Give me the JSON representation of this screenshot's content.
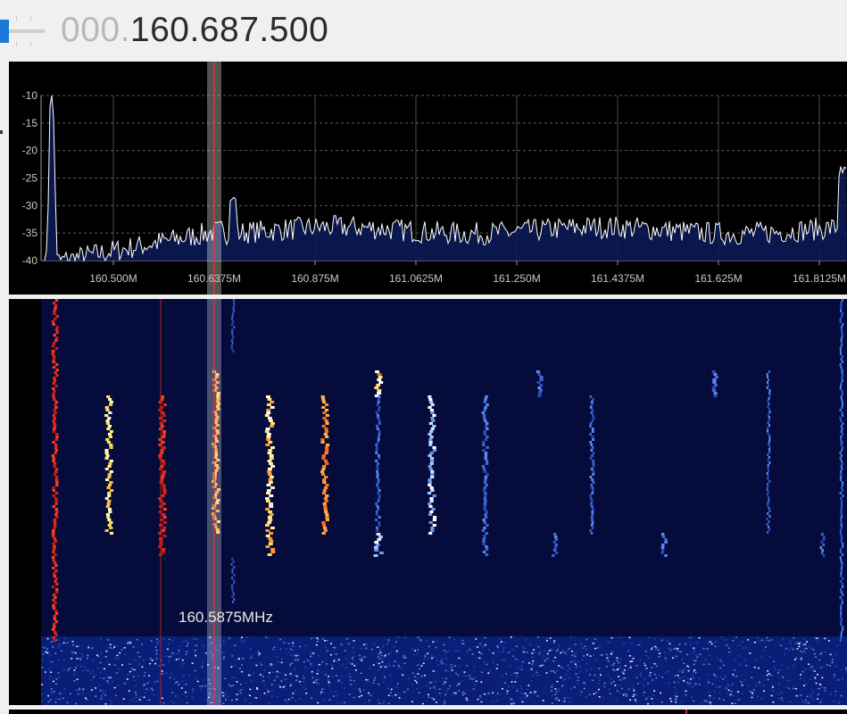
{
  "frequency": {
    "dim_part": "000.",
    "bright_part": "160.687.500"
  },
  "spectrum": {
    "y_ticks": [
      "-10",
      "-15",
      "-20",
      "-25",
      "-30",
      "-35",
      "-40"
    ],
    "x_ticks": [
      "160.500M",
      "160.6375M",
      "160.875M",
      "161.0625M",
      "161.250M",
      "161.4375M",
      "161.625M",
      "161.8125M"
    ]
  },
  "waterfall": {
    "cursor_readout": "160.5875MHz"
  },
  "colors": {
    "accent": "#1a78d6",
    "trace": "#ffffff",
    "fill": "#0b1a55",
    "cursor_line": "#d23a3a",
    "waterfall_bg": "#050b3a"
  }
}
